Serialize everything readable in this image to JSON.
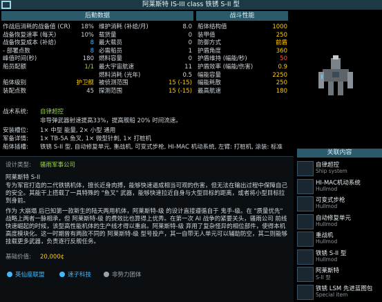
{
  "window_title": "阿莱斯特 IS-III class 铁锈 S-II 型",
  "logistics": {
    "header": "后勤数据",
    "left_rows": [
      {
        "label": "作战后消耗的战备值 (CR)",
        "value": "18%",
        "color": "#cfd6dc"
      },
      {
        "label": "战备恢复速率 (每天)",
        "value": "10%",
        "color": "#cfd6dc"
      },
      {
        "label": "战备恢复成本 (补给)",
        "value": "8",
        "color": "#3fb9ff"
      },
      {
        "label": "- 部署点数",
        "value": "8",
        "color": "#3fb9ff"
      },
      {
        "label": "峰值时间(秒)",
        "value": "180",
        "color": "#cfd6dc"
      },
      {
        "label": "船员配额",
        "value": "1/1",
        "color": "#9bd24a"
      },
      {
        "label": "",
        "value": "",
        "color": "#cfd6dc"
      },
      {
        "label": "船体级别",
        "value": "护卫舰",
        "color": "#ffcc00"
      },
      {
        "label": "装配点数",
        "value": "45",
        "color": "#cfd6dc"
      }
    ],
    "right_rows": [
      {
        "label": "维护消耗 (补给/月)",
        "value": "8.0",
        "color": "#cfd6dc"
      },
      {
        "label": "载货量",
        "value": "0",
        "color": "#cfd6dc"
      },
      {
        "label": "最大载员",
        "value": "0",
        "color": "#cfd6dc"
      },
      {
        "label": "必需船员",
        "value": "1",
        "color": "#cfd6dc"
      },
      {
        "label": "燃料容量",
        "value": "0",
        "color": "#cfd6dc"
      },
      {
        "label": "最大宇宙航速",
        "value": "11",
        "color": "#cfd6dc"
      },
      {
        "label": "燃料消耗 (光年)",
        "value": "0.5",
        "color": "#cfd6dc"
      },
      {
        "label": "被侦测范围",
        "value": "15 (-15)",
        "color": "#ffcc00"
      },
      {
        "label": "探测范围",
        "value": "15 (-15)",
        "color": "#ffcc00"
      }
    ]
  },
  "combat": {
    "header": "战斗性能",
    "rows": [
      {
        "label": "船体结构值",
        "value": "1000",
        "color": "#ffcc00"
      },
      {
        "label": "装甲值",
        "value": "250",
        "color": "#ffcc00"
      },
      {
        "label": "防御方式",
        "value": "前盾",
        "color": "#ffcc00"
      },
      {
        "label": "护盾角度",
        "value": "360",
        "color": "#ffcc00"
      },
      {
        "label": "护盾维持 (幅能/秒)",
        "value": "50",
        "color": "#ff5a3a"
      },
      {
        "label": "护盾效率 (幅能/伤害)",
        "value": "0.9",
        "color": "#ffcc00"
      },
      {
        "label": "幅能容量",
        "value": "2250",
        "color": "#ffcc00"
      },
      {
        "label": "幅能耗散",
        "value": "250",
        "color": "#ffcc00"
      },
      {
        "label": "最高航速",
        "value": "180",
        "color": "#ffcc00"
      }
    ]
  },
  "systems": {
    "tactical_label": "战术系统:",
    "tactical_value": "自律超控",
    "tactical_desc": "非导弹武器射速提高33%，提高舰船 20% 时间流速。",
    "mounts_label": "安装槽位:",
    "mounts_value": "1× 中型 能量, 2× 小型 通用",
    "weapons_label": "军备详情:",
    "weapons_value": "1× TB-5A 鱼叉, 1× 微型针刺, 1× 打桩机",
    "hullmods_label": "船体插槽:",
    "hullmods_value": "铁锈 S-II 型, 自动修复单元, 重战机, 可变式步枪, HI-MAC 机动系统, 左臂: 打桩机, 涂装: 标准"
  },
  "design": {
    "type_label": "设计类型:",
    "type_value": "骚雨军事公司",
    "name_line": "阿莱斯特 S-II",
    "paragraph1": "专为军官打造的二代铁锈机体，擅长近身肉搏，能够快速逼成相当可观的伤害，但无法在输出过程中保障自己的安全。其能干上搭载了一具特殊的 \"鱼叉\" 武器，能够快速拉近自身与大型目标的距离，或者将小型目标拉到身前。",
    "paragraph2": "作为 大崩塌 后已知第一款新生的陆天两用机体，阿莱斯特-级 的设计直接遵循自于 鬼手-级。在 \"质量优先\" 战略上两者一脉相承，但 阿莱斯特-级 的费效比也算得上优秀。在第一次 AI 战争的紧要关头，骚雨公司 前线快速崛起的时候，该型高性能机体的生产线才得以重启。阿莱斯特-级 弃用了复杂怪异的相位部件，使得本机高度模块化。这一时期曾有两款不同的 阿莱斯特-级 型号投产，其一自带无人单元可以辅助防空，其二则能够挂载更多武器，负责逐行反舰任务。",
    "base_value_label": "基础价值:",
    "base_value": "20,000¢"
  },
  "factions": [
    {
      "name": "英仙座联盟",
      "color": "#3fb9ff"
    },
    {
      "name": "速子科技",
      "color": "#3fb9ff"
    },
    {
      "name": "非势力团体",
      "color": "#9aa3aa"
    }
  ],
  "related": {
    "header": "关联内容",
    "items": [
      {
        "name": "自律超控",
        "sub": "Ship system",
        "icon": "ship-system-icon"
      },
      {
        "name": "HI-MAC机动系统",
        "sub": "Hullmod",
        "icon": "hullmod-icon"
      },
      {
        "name": "可变式步枪",
        "sub": "Hullmod",
        "icon": "hullmod-icon"
      },
      {
        "name": "自动修复单元",
        "sub": "Hullmod",
        "icon": "hullmod-icon"
      },
      {
        "name": "重战机",
        "sub": "Hullmod",
        "icon": "hullmod-icon"
      },
      {
        "name": "铁锈 S-II 型",
        "sub": "Hullmod",
        "icon": "hullmod-icon"
      },
      {
        "name": "阿莱斯特",
        "sub": "S-II 型",
        "icon": "ship-icon"
      },
      {
        "name": "铁锈 LSM 先进蓝图包",
        "sub": "Special item",
        "icon": "blueprint-icon"
      }
    ]
  }
}
